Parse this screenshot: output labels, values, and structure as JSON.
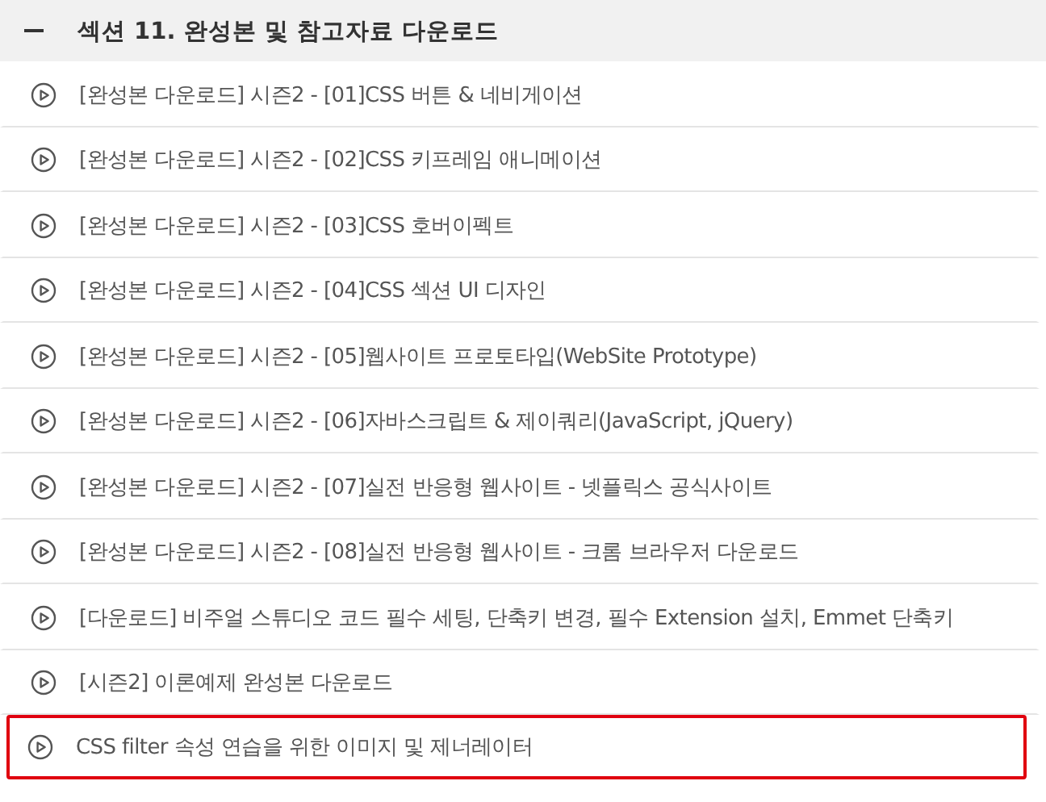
{
  "section": {
    "title": "섹션 11. 완성본 및 참고자료 다운로드",
    "expanded": true
  },
  "lectures": [
    {
      "title": "[완성본 다운로드] 시즌2 - [01]CSS 버튼 & 네비게이션",
      "highlighted": false
    },
    {
      "title": "[완성본 다운로드] 시즌2 - [02]CSS 키프레임 애니메이션",
      "highlighted": false
    },
    {
      "title": "[완성본 다운로드] 시즌2 - [03]CSS 호버이펙트",
      "highlighted": false
    },
    {
      "title": "[완성본 다운로드] 시즌2 - [04]CSS 섹션 UI 디자인",
      "highlighted": false
    },
    {
      "title": "[완성본 다운로드] 시즌2 - [05]웹사이트 프로토타입(WebSite Prototype)",
      "highlighted": false
    },
    {
      "title": "[완성본 다운로드] 시즌2 - [06]자바스크립트 & 제이쿼리(JavaScript, jQuery)",
      "highlighted": false
    },
    {
      "title": "[완성본 다운로드] 시즌2 - [07]실전 반응형 웹사이트 - 넷플릭스 공식사이트",
      "highlighted": false
    },
    {
      "title": "[완성본 다운로드] 시즌2 - [08]실전 반응형 웹사이트 - 크롬 브라우저 다운로드",
      "highlighted": false
    },
    {
      "title": "[다운로드] 비주얼 스튜디오 코드 필수 세팅, 단축키 변경, 필수 Extension 설치, Emmet 단축키",
      "highlighted": false
    },
    {
      "title": "[시즌2] 이론예제 완성본 다운로드",
      "highlighted": false
    },
    {
      "title": "CSS filter 속성 연습을 위한 이미지 및 제너레이터",
      "highlighted": true
    }
  ]
}
